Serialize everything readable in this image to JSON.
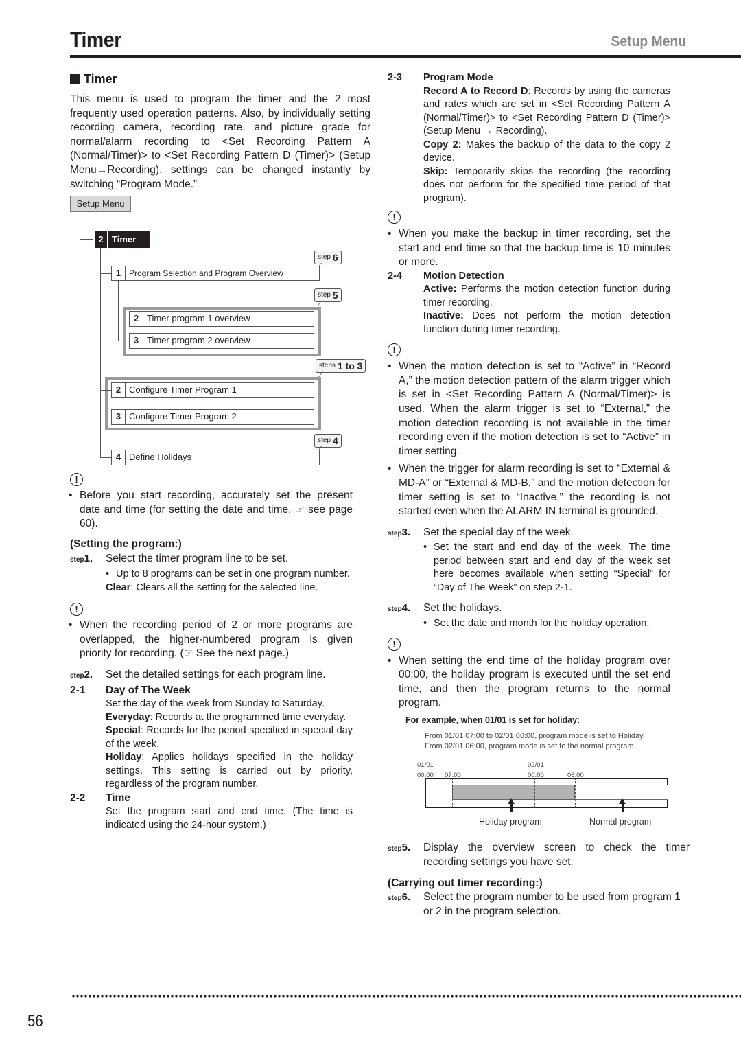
{
  "header": {
    "title": "Timer",
    "section": "Setup Menu"
  },
  "left": {
    "section_title": "Timer",
    "intro": "This menu is used to program the timer and the 2 most frequently used operation patterns. Also, by individually setting recording camera, recording rate, and picture grade for normal/alarm recording to <Set Recording Pattern A (Normal/Timer)> to <Set Recording Pattern D (Timer)> (Setup Menu→Recording), settings can be changed instantly by switching “Program Mode.”",
    "diagram": {
      "root": "Setup Menu",
      "timer_num": "2",
      "timer_label": "Timer",
      "items": [
        {
          "num": "1",
          "label": "Program Selection and Program Overview"
        },
        {
          "num": "2",
          "label": "Timer program 1 overview"
        },
        {
          "num": "3",
          "label": "Timer program 2 overview"
        },
        {
          "num": "2",
          "label": "Configure Timer Program 1"
        },
        {
          "num": "3",
          "label": "Configure Timer Program 2"
        },
        {
          "num": "4",
          "label": "Define Holidays"
        }
      ],
      "tags": [
        {
          "prefix": "step",
          "value": "6"
        },
        {
          "prefix": "step",
          "value": "5"
        },
        {
          "prefix": "steps",
          "value": "1 to 3"
        },
        {
          "prefix": "step",
          "value": "4"
        }
      ]
    },
    "caution1": "Before you start recording, accurately set the present date and time (for setting the date and time, ☞ see page 60).",
    "setting_head": "(Setting the program:)",
    "step1": {
      "prefix": "step",
      "num": "1.",
      "text": "Select the timer program line to be set."
    },
    "step1_bullet": "Up to 8 programs can be set in one program number.",
    "step1_clear_label": "Clear",
    "step1_clear_text": ": Clears all the setting for the selected line.",
    "caution2": "When the recording period of 2 or more programs are overlapped, the higher-numbered program is given priority for recording. (☞ See the next page.)",
    "step2": {
      "prefix": "step",
      "num": "2.",
      "text": "Set the detailed settings for each program line."
    },
    "s21": {
      "num": "2-1",
      "title": "Day of The Week",
      "text": "Set the day of the week from Sunday to Saturday."
    },
    "s21_everyday_label": "Everyday",
    "s21_everyday_text": ": Records at the programmed time everyday.",
    "s21_special_label": "Special",
    "s21_special_text": ": Records for the period specified in special day of the week.",
    "s21_holiday_label": "Holiday",
    "s21_holiday_text": ": Applies holidays specified in the holiday settings. This setting is carried out by priority, regardless of the program number.",
    "s22": {
      "num": "2-2",
      "title": "Time",
      "text": "Set the program start and end time. (The time is indicated using the 24-hour system.)"
    }
  },
  "right": {
    "s23": {
      "num": "2-3",
      "title": "Program Mode"
    },
    "s23_rec_label": "Record A to Record D",
    "s23_rec_text": ": Records by using the cameras and rates which are set in <Set Recording Pattern A (Normal/Timer)> to <Set Recording Pattern D (Timer)> (Setup Menu → Recording).",
    "s23_copy_label": "Copy 2:",
    "s23_copy_text": " Makes the backup of the data to the copy 2 device.",
    "s23_skip_label": "Skip:",
    "s23_skip_text": " Temporarily skips the recording (the recording does not perform for the specified time period of that program).",
    "caution3": "When you make the backup in timer recording, set the start and end time so that the backup time is 10 minutes or more.",
    "s24": {
      "num": "2-4",
      "title": "Motion Detection"
    },
    "s24_active_label": "Active:",
    "s24_active_text": " Performs the motion detection function during timer recording.",
    "s24_inactive_label": "Inactive:",
    "s24_inactive_text": " Does not perform the motion detection function during timer recording.",
    "caution4a": "When the motion detection is set to “Active” in “Record A,” the motion detection pattern of the alarm trigger which is set in <Set Recording Pattern A (Normal/Timer)> is used. When the alarm trigger is set to “External,” the motion detection recording is not available in the timer recording even if the motion detection is set to “Active” in timer setting.",
    "caution4b": "When the trigger for alarm recording is set to “External & MD-A” or “External & MD-B,” and the motion detection for timer setting is set to “Inactive,” the recording is not started even when the ALARM IN terminal is grounded.",
    "step3": {
      "prefix": "step",
      "num": "3.",
      "text": "Set the special day of the week."
    },
    "step3_bullet": "Set the start and end day of the week. The time period between start and end day of the week set here becomes available when setting “Special” for “Day of The Week” on step 2-1.",
    "step4": {
      "prefix": "step",
      "num": "4.",
      "text": "Set the holidays."
    },
    "step4_bullet": "Set the date and month for the holiday operation.",
    "caution5": "When setting the end time of the holiday program over 00:00, the holiday program is executed until the set end time, and then the program returns to the normal program.",
    "example_head": "For example, when 01/01 is set for holiday:",
    "example_line1": "From 01/01 07:00 to 02/01 06:00, program mode is set to Holiday.",
    "example_line2": "From 02/01 06:00, program mode is set to the normal program.",
    "timeline": {
      "date1": "01/01",
      "date2": "02/01",
      "t0": "00:00",
      "t1": "07:00",
      "t2": "00:00",
      "t3": "06:00",
      "holiday_caption": "Holiday program",
      "normal_caption": "Normal program"
    },
    "step5": {
      "prefix": "step",
      "num": "5.",
      "text": "Display the overview screen to check the timer recording settings you have set."
    },
    "carrying_head": "(Carrying out timer recording:)",
    "step6": {
      "prefix": "step",
      "num": "6.",
      "text": "Select the program number to be used from program 1 or 2 in the program selection."
    }
  },
  "footer": {
    "page_number": "56"
  },
  "icons": {
    "caution": "!"
  }
}
